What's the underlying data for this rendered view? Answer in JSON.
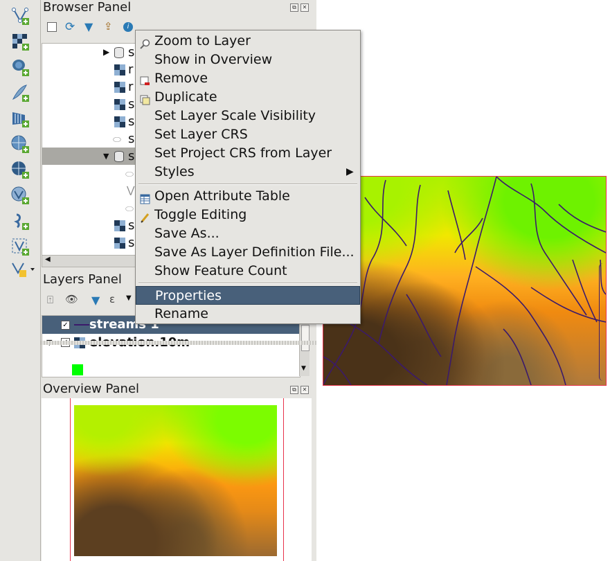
{
  "browser_panel": {
    "title": "Browser Panel",
    "rows": [
      {
        "label": "s",
        "kind": "db",
        "expanded": false
      },
      {
        "label": "r",
        "kind": "raster"
      },
      {
        "label": "r",
        "kind": "raster"
      },
      {
        "label": "s",
        "kind": "raster"
      },
      {
        "label": "s",
        "kind": "raster"
      },
      {
        "label": "s",
        "kind": "polygon"
      },
      {
        "label": "s",
        "kind": "db",
        "expanded": true
      },
      {
        "label": "",
        "kind": "polygon-child"
      },
      {
        "label": "",
        "kind": "line-child"
      },
      {
        "label": "",
        "kind": "polygon-child"
      },
      {
        "label": "s",
        "kind": "raster"
      },
      {
        "label": "s",
        "kind": "raster"
      }
    ]
  },
  "layers_panel": {
    "title": "Layers Panel",
    "layers": [
      {
        "name": "streams 1",
        "checked": true,
        "selected": true
      },
      {
        "name": "elevation.10m",
        "checked": true,
        "selected": false
      }
    ],
    "legend_color": "#00ff00"
  },
  "overview_panel": {
    "title": "Overview Panel"
  },
  "context_menu": {
    "items": [
      {
        "label": "Zoom to Layer",
        "icon": "zoom-icon"
      },
      {
        "label": "Show in Overview",
        "icon": ""
      },
      {
        "label": "Remove",
        "icon": "remove-icon"
      },
      {
        "label": "Duplicate",
        "icon": "duplicate-icon"
      },
      {
        "label": "Set Layer Scale Visibility",
        "icon": ""
      },
      {
        "label": "Set Layer CRS",
        "icon": ""
      },
      {
        "label": "Set Project CRS from Layer",
        "icon": ""
      },
      {
        "label": "Styles",
        "icon": "",
        "submenu": true
      },
      {
        "label": "Open Attribute Table",
        "icon": "table-icon"
      },
      {
        "label": "Toggle Editing",
        "icon": "pencil-icon"
      },
      {
        "label": "Save As...",
        "icon": ""
      },
      {
        "label": "Save As Layer Definition File...",
        "icon": ""
      },
      {
        "label": "Show Feature Count",
        "icon": ""
      },
      {
        "label": "Properties",
        "icon": "",
        "highlighted": true
      },
      {
        "label": "Rename",
        "icon": ""
      }
    ]
  },
  "colors": {
    "accent_highlight": "#48607a",
    "map_frame": "#e8324a",
    "stream_line": "#3b1a6b"
  }
}
